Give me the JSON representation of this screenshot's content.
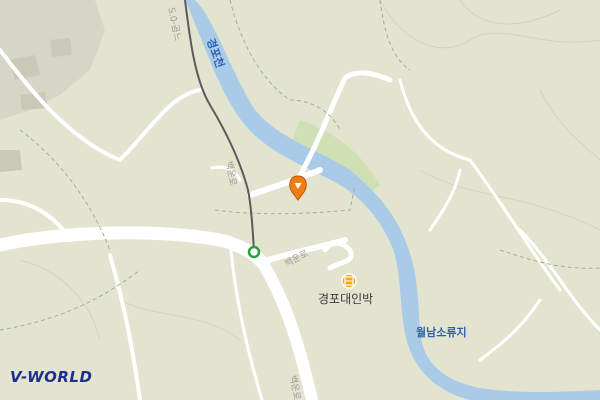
{
  "map": {
    "provider_logo": "V-WORLD",
    "labels": {
      "river_north": "경포천",
      "river_south": "월남소류지",
      "poi_name": "경포대인박",
      "road_top": "S.0-곰느",
      "road_north": "백운로",
      "road_center": "백운로",
      "road_south": "백운로"
    },
    "markers": [
      {
        "name": "location-pin",
        "color": "#f07d14"
      },
      {
        "name": "transit-stop",
        "color": "#26a03c"
      },
      {
        "name": "lodging-icon",
        "color": "#f0a81e"
      }
    ],
    "colors": {
      "background": "#e3e4cf",
      "water": "#a9cbe8",
      "park": "#cfe1b4",
      "road": "#ffffff",
      "rail": "#5c5c5c"
    }
  }
}
